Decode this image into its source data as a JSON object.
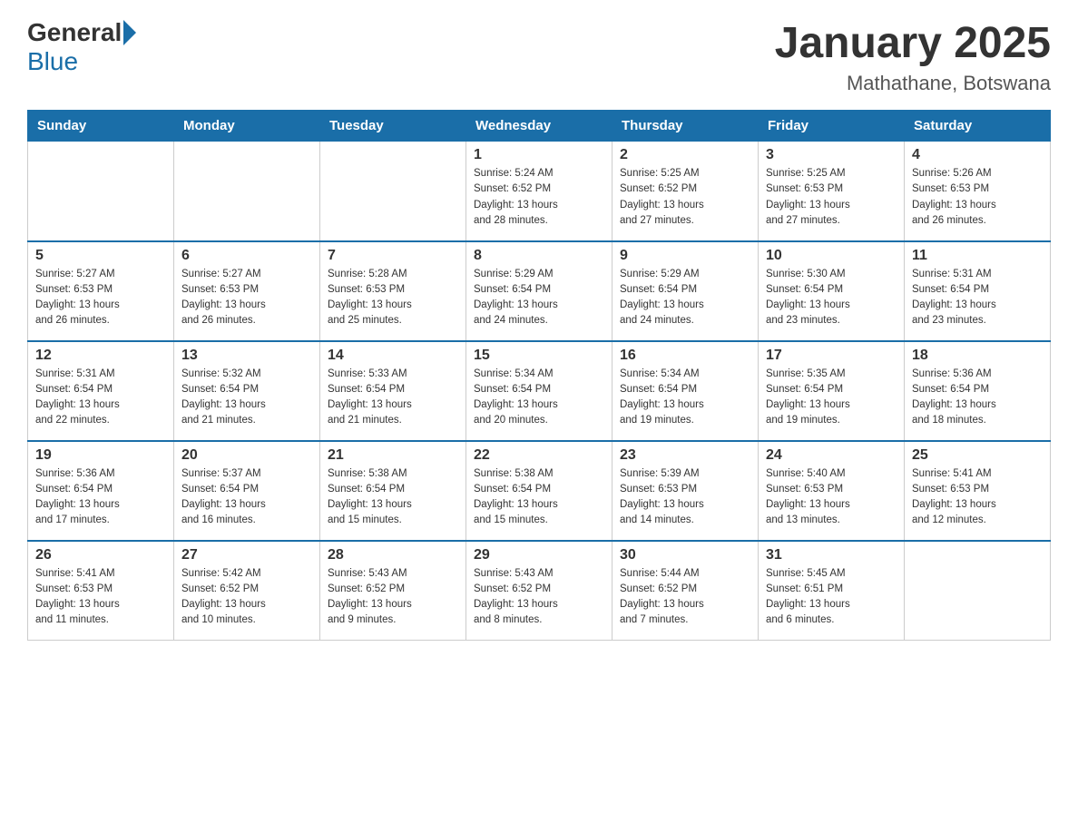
{
  "header": {
    "logo_general": "General",
    "logo_blue": "Blue",
    "title": "January 2025",
    "subtitle": "Mathathane, Botswana"
  },
  "days_of_week": [
    "Sunday",
    "Monday",
    "Tuesday",
    "Wednesday",
    "Thursday",
    "Friday",
    "Saturday"
  ],
  "weeks": [
    [
      {
        "day": "",
        "info": ""
      },
      {
        "day": "",
        "info": ""
      },
      {
        "day": "",
        "info": ""
      },
      {
        "day": "1",
        "info": "Sunrise: 5:24 AM\nSunset: 6:52 PM\nDaylight: 13 hours\nand 28 minutes."
      },
      {
        "day": "2",
        "info": "Sunrise: 5:25 AM\nSunset: 6:52 PM\nDaylight: 13 hours\nand 27 minutes."
      },
      {
        "day": "3",
        "info": "Sunrise: 5:25 AM\nSunset: 6:53 PM\nDaylight: 13 hours\nand 27 minutes."
      },
      {
        "day": "4",
        "info": "Sunrise: 5:26 AM\nSunset: 6:53 PM\nDaylight: 13 hours\nand 26 minutes."
      }
    ],
    [
      {
        "day": "5",
        "info": "Sunrise: 5:27 AM\nSunset: 6:53 PM\nDaylight: 13 hours\nand 26 minutes."
      },
      {
        "day": "6",
        "info": "Sunrise: 5:27 AM\nSunset: 6:53 PM\nDaylight: 13 hours\nand 26 minutes."
      },
      {
        "day": "7",
        "info": "Sunrise: 5:28 AM\nSunset: 6:53 PM\nDaylight: 13 hours\nand 25 minutes."
      },
      {
        "day": "8",
        "info": "Sunrise: 5:29 AM\nSunset: 6:54 PM\nDaylight: 13 hours\nand 24 minutes."
      },
      {
        "day": "9",
        "info": "Sunrise: 5:29 AM\nSunset: 6:54 PM\nDaylight: 13 hours\nand 24 minutes."
      },
      {
        "day": "10",
        "info": "Sunrise: 5:30 AM\nSunset: 6:54 PM\nDaylight: 13 hours\nand 23 minutes."
      },
      {
        "day": "11",
        "info": "Sunrise: 5:31 AM\nSunset: 6:54 PM\nDaylight: 13 hours\nand 23 minutes."
      }
    ],
    [
      {
        "day": "12",
        "info": "Sunrise: 5:31 AM\nSunset: 6:54 PM\nDaylight: 13 hours\nand 22 minutes."
      },
      {
        "day": "13",
        "info": "Sunrise: 5:32 AM\nSunset: 6:54 PM\nDaylight: 13 hours\nand 21 minutes."
      },
      {
        "day": "14",
        "info": "Sunrise: 5:33 AM\nSunset: 6:54 PM\nDaylight: 13 hours\nand 21 minutes."
      },
      {
        "day": "15",
        "info": "Sunrise: 5:34 AM\nSunset: 6:54 PM\nDaylight: 13 hours\nand 20 minutes."
      },
      {
        "day": "16",
        "info": "Sunrise: 5:34 AM\nSunset: 6:54 PM\nDaylight: 13 hours\nand 19 minutes."
      },
      {
        "day": "17",
        "info": "Sunrise: 5:35 AM\nSunset: 6:54 PM\nDaylight: 13 hours\nand 19 minutes."
      },
      {
        "day": "18",
        "info": "Sunrise: 5:36 AM\nSunset: 6:54 PM\nDaylight: 13 hours\nand 18 minutes."
      }
    ],
    [
      {
        "day": "19",
        "info": "Sunrise: 5:36 AM\nSunset: 6:54 PM\nDaylight: 13 hours\nand 17 minutes."
      },
      {
        "day": "20",
        "info": "Sunrise: 5:37 AM\nSunset: 6:54 PM\nDaylight: 13 hours\nand 16 minutes."
      },
      {
        "day": "21",
        "info": "Sunrise: 5:38 AM\nSunset: 6:54 PM\nDaylight: 13 hours\nand 15 minutes."
      },
      {
        "day": "22",
        "info": "Sunrise: 5:38 AM\nSunset: 6:54 PM\nDaylight: 13 hours\nand 15 minutes."
      },
      {
        "day": "23",
        "info": "Sunrise: 5:39 AM\nSunset: 6:53 PM\nDaylight: 13 hours\nand 14 minutes."
      },
      {
        "day": "24",
        "info": "Sunrise: 5:40 AM\nSunset: 6:53 PM\nDaylight: 13 hours\nand 13 minutes."
      },
      {
        "day": "25",
        "info": "Sunrise: 5:41 AM\nSunset: 6:53 PM\nDaylight: 13 hours\nand 12 minutes."
      }
    ],
    [
      {
        "day": "26",
        "info": "Sunrise: 5:41 AM\nSunset: 6:53 PM\nDaylight: 13 hours\nand 11 minutes."
      },
      {
        "day": "27",
        "info": "Sunrise: 5:42 AM\nSunset: 6:52 PM\nDaylight: 13 hours\nand 10 minutes."
      },
      {
        "day": "28",
        "info": "Sunrise: 5:43 AM\nSunset: 6:52 PM\nDaylight: 13 hours\nand 9 minutes."
      },
      {
        "day": "29",
        "info": "Sunrise: 5:43 AM\nSunset: 6:52 PM\nDaylight: 13 hours\nand 8 minutes."
      },
      {
        "day": "30",
        "info": "Sunrise: 5:44 AM\nSunset: 6:52 PM\nDaylight: 13 hours\nand 7 minutes."
      },
      {
        "day": "31",
        "info": "Sunrise: 5:45 AM\nSunset: 6:51 PM\nDaylight: 13 hours\nand 6 minutes."
      },
      {
        "day": "",
        "info": ""
      }
    ]
  ]
}
